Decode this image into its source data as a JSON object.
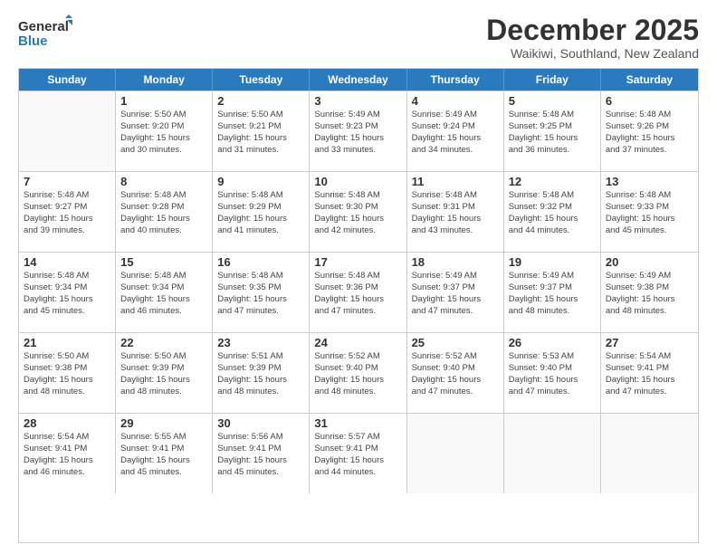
{
  "logo": {
    "line1": "General",
    "line2": "Blue"
  },
  "title": "December 2025",
  "location": "Waikiwi, Southland, New Zealand",
  "weekdays": [
    "Sunday",
    "Monday",
    "Tuesday",
    "Wednesday",
    "Thursday",
    "Friday",
    "Saturday"
  ],
  "rows": [
    [
      {
        "day": "",
        "info": ""
      },
      {
        "day": "1",
        "info": "Sunrise: 5:50 AM\nSunset: 9:20 PM\nDaylight: 15 hours\nand 30 minutes."
      },
      {
        "day": "2",
        "info": "Sunrise: 5:50 AM\nSunset: 9:21 PM\nDaylight: 15 hours\nand 31 minutes."
      },
      {
        "day": "3",
        "info": "Sunrise: 5:49 AM\nSunset: 9:23 PM\nDaylight: 15 hours\nand 33 minutes."
      },
      {
        "day": "4",
        "info": "Sunrise: 5:49 AM\nSunset: 9:24 PM\nDaylight: 15 hours\nand 34 minutes."
      },
      {
        "day": "5",
        "info": "Sunrise: 5:48 AM\nSunset: 9:25 PM\nDaylight: 15 hours\nand 36 minutes."
      },
      {
        "day": "6",
        "info": "Sunrise: 5:48 AM\nSunset: 9:26 PM\nDaylight: 15 hours\nand 37 minutes."
      }
    ],
    [
      {
        "day": "7",
        "info": "Sunrise: 5:48 AM\nSunset: 9:27 PM\nDaylight: 15 hours\nand 39 minutes."
      },
      {
        "day": "8",
        "info": "Sunrise: 5:48 AM\nSunset: 9:28 PM\nDaylight: 15 hours\nand 40 minutes."
      },
      {
        "day": "9",
        "info": "Sunrise: 5:48 AM\nSunset: 9:29 PM\nDaylight: 15 hours\nand 41 minutes."
      },
      {
        "day": "10",
        "info": "Sunrise: 5:48 AM\nSunset: 9:30 PM\nDaylight: 15 hours\nand 42 minutes."
      },
      {
        "day": "11",
        "info": "Sunrise: 5:48 AM\nSunset: 9:31 PM\nDaylight: 15 hours\nand 43 minutes."
      },
      {
        "day": "12",
        "info": "Sunrise: 5:48 AM\nSunset: 9:32 PM\nDaylight: 15 hours\nand 44 minutes."
      },
      {
        "day": "13",
        "info": "Sunrise: 5:48 AM\nSunset: 9:33 PM\nDaylight: 15 hours\nand 45 minutes."
      }
    ],
    [
      {
        "day": "14",
        "info": "Sunrise: 5:48 AM\nSunset: 9:34 PM\nDaylight: 15 hours\nand 45 minutes."
      },
      {
        "day": "15",
        "info": "Sunrise: 5:48 AM\nSunset: 9:34 PM\nDaylight: 15 hours\nand 46 minutes."
      },
      {
        "day": "16",
        "info": "Sunrise: 5:48 AM\nSunset: 9:35 PM\nDaylight: 15 hours\nand 47 minutes."
      },
      {
        "day": "17",
        "info": "Sunrise: 5:48 AM\nSunset: 9:36 PM\nDaylight: 15 hours\nand 47 minutes."
      },
      {
        "day": "18",
        "info": "Sunrise: 5:49 AM\nSunset: 9:37 PM\nDaylight: 15 hours\nand 47 minutes."
      },
      {
        "day": "19",
        "info": "Sunrise: 5:49 AM\nSunset: 9:37 PM\nDaylight: 15 hours\nand 48 minutes."
      },
      {
        "day": "20",
        "info": "Sunrise: 5:49 AM\nSunset: 9:38 PM\nDaylight: 15 hours\nand 48 minutes."
      }
    ],
    [
      {
        "day": "21",
        "info": "Sunrise: 5:50 AM\nSunset: 9:38 PM\nDaylight: 15 hours\nand 48 minutes."
      },
      {
        "day": "22",
        "info": "Sunrise: 5:50 AM\nSunset: 9:39 PM\nDaylight: 15 hours\nand 48 minutes."
      },
      {
        "day": "23",
        "info": "Sunrise: 5:51 AM\nSunset: 9:39 PM\nDaylight: 15 hours\nand 48 minutes."
      },
      {
        "day": "24",
        "info": "Sunrise: 5:52 AM\nSunset: 9:40 PM\nDaylight: 15 hours\nand 48 minutes."
      },
      {
        "day": "25",
        "info": "Sunrise: 5:52 AM\nSunset: 9:40 PM\nDaylight: 15 hours\nand 47 minutes."
      },
      {
        "day": "26",
        "info": "Sunrise: 5:53 AM\nSunset: 9:40 PM\nDaylight: 15 hours\nand 47 minutes."
      },
      {
        "day": "27",
        "info": "Sunrise: 5:54 AM\nSunset: 9:41 PM\nDaylight: 15 hours\nand 47 minutes."
      }
    ],
    [
      {
        "day": "28",
        "info": "Sunrise: 5:54 AM\nSunset: 9:41 PM\nDaylight: 15 hours\nand 46 minutes."
      },
      {
        "day": "29",
        "info": "Sunrise: 5:55 AM\nSunset: 9:41 PM\nDaylight: 15 hours\nand 45 minutes."
      },
      {
        "day": "30",
        "info": "Sunrise: 5:56 AM\nSunset: 9:41 PM\nDaylight: 15 hours\nand 45 minutes."
      },
      {
        "day": "31",
        "info": "Sunrise: 5:57 AM\nSunset: 9:41 PM\nDaylight: 15 hours\nand 44 minutes."
      },
      {
        "day": "",
        "info": ""
      },
      {
        "day": "",
        "info": ""
      },
      {
        "day": "",
        "info": ""
      }
    ]
  ]
}
